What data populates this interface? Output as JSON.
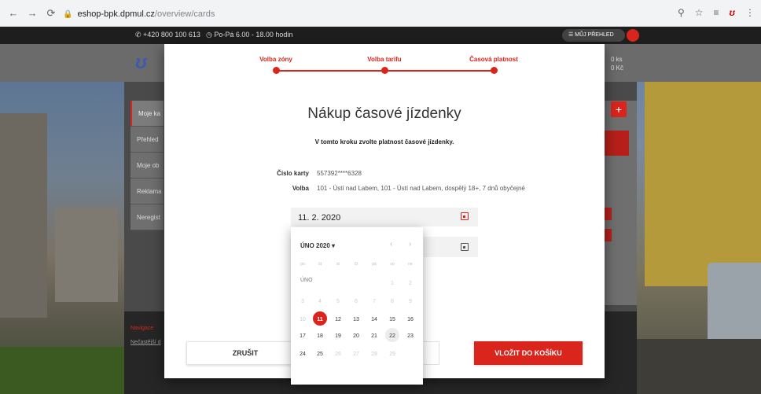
{
  "browser": {
    "url_host": "eshop-bpk.dpmul.cz",
    "url_path": "/overview/cards"
  },
  "topbar": {
    "phone": "+420 800 100 613",
    "hours": "Po-Pá 6.00 - 18.00 hodin",
    "overview_button": "MŮJ PŘEHLED"
  },
  "site": {
    "cart_count": "0 ks",
    "cart_total": "0 Kč",
    "side_menu": [
      "Moje ka",
      "Přehled",
      "Moje ob",
      "Reklama",
      "Neregist"
    ],
    "footer_label": "Navigace",
    "footer_link": "Nečastější d"
  },
  "modal": {
    "steps": [
      "Volba zóny",
      "Volba tarifu",
      "Časová platnost"
    ],
    "title": "Nákup časové jízdenky",
    "subtitle": "V tomto kroku zvolte platnost časové jízdenky.",
    "card_label": "Číslo karty",
    "card_value": "557392****6328",
    "option_label": "Volba",
    "option_value": "101 - Ústí nad Labem, 101 - Ústí nad Labem, dospělý 18+, 7 dnů obyčejné",
    "date_value": "11. 2. 2020",
    "cancel_label": "ZRUŠIT",
    "add_label": "VLOŽIT DO KOŠÍKU"
  },
  "datepicker": {
    "month_year": "ÚNO 2020",
    "weekdays": [
      "po",
      "út",
      "st",
      "čt",
      "pá",
      "so",
      "ne"
    ],
    "month_short": "ÚNO",
    "days": [
      [
        "",
        "",
        "",
        "",
        "",
        "1",
        "2"
      ],
      [
        "3",
        "4",
        "5",
        "6",
        "7",
        "8",
        "9"
      ],
      [
        "10",
        "11",
        "12",
        "13",
        "14",
        "15",
        "16"
      ],
      [
        "17",
        "18",
        "19",
        "20",
        "21",
        "22",
        "23"
      ],
      [
        "24",
        "25",
        "26",
        "27",
        "28",
        "29",
        ""
      ]
    ],
    "selected_day": "11",
    "today_day": "22"
  },
  "colors": {
    "accent": "#d9251c",
    "modal_bg": "#ffffff"
  }
}
